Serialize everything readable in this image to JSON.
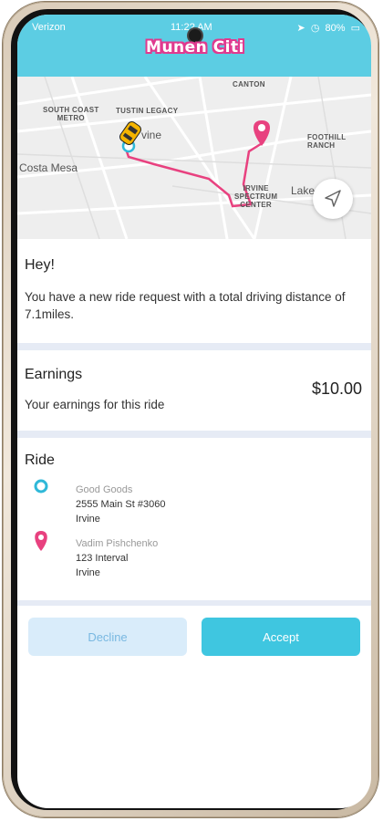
{
  "status_bar": {
    "carrier": "Verizon",
    "time": "11:2? AM",
    "battery": "80%"
  },
  "header": {
    "app_logo_text": "Munen Citi"
  },
  "map": {
    "labels": {
      "canton": "CANTON",
      "south_coast_metro": "SOUTH COAST\nMETRO",
      "tustin_legacy": "TUSTIN LEGACY",
      "irvine_partial": "vine",
      "costa_mesa": "Costa Mesa",
      "irvine_spectrum": "IRVINE\nSPECTRUM\nCENTER",
      "foothill_ranch": "FOOTHILL RANCH",
      "lake_forest_partial": "Lake F"
    },
    "colors": {
      "route": "#e8417f",
      "pin": "#e8417f",
      "taxi": "#f4b400"
    }
  },
  "request": {
    "greeting": "Hey!",
    "message": "You have a new ride request with a total driving distance of 7.1miles."
  },
  "earnings": {
    "title": "Earnings",
    "subtitle": "Your earnings for this ride",
    "amount": "$10.00"
  },
  "ride": {
    "title": "Ride",
    "pickup": {
      "name": "Good Goods",
      "address1": "2555 Main St #3060",
      "city": "Irvine"
    },
    "dropoff": {
      "name": "Vadim Pishchenko",
      "address1": "123 Interval",
      "city": "Irvine"
    },
    "colors": {
      "pickup": "#2fb8d8",
      "dropoff": "#e8417f"
    }
  },
  "actions": {
    "decline_label": "Decline",
    "accept_label": "Accept"
  }
}
